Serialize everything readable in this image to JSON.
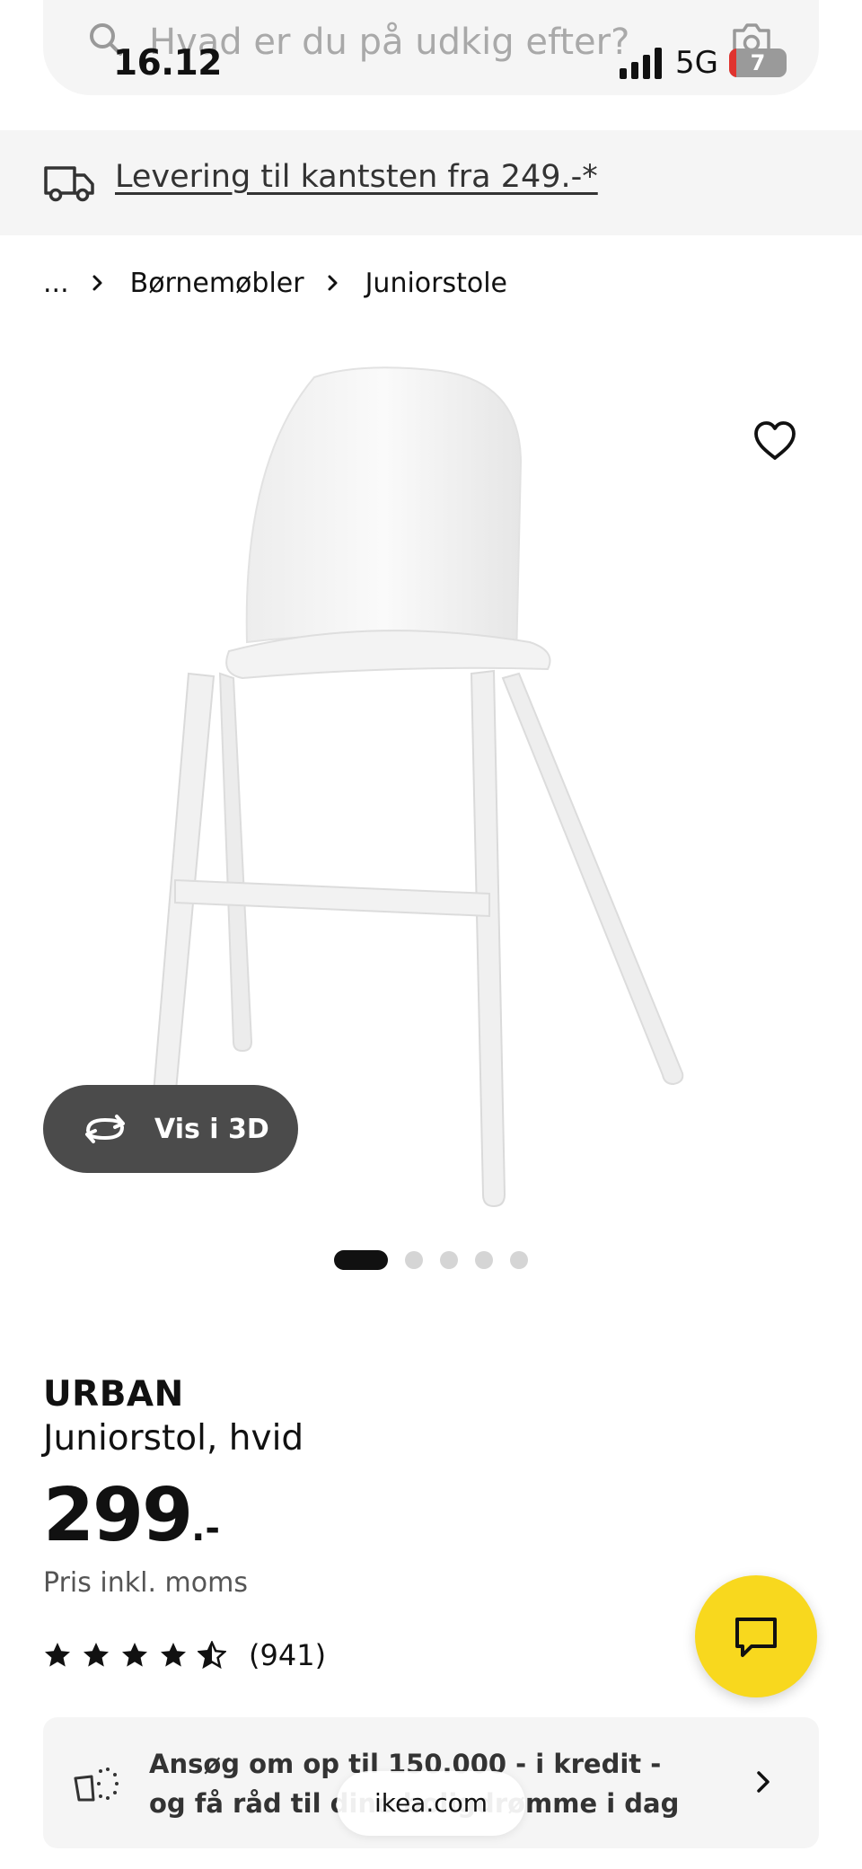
{
  "status_bar": {
    "time": "16.12",
    "network": "5G",
    "battery_level": "7"
  },
  "search": {
    "placeholder": "Hvad er du på udkig efter?"
  },
  "delivery_banner": {
    "text": "Levering til kantsten fra 249.-*"
  },
  "breadcrumb": {
    "ellipsis": "...",
    "items": [
      "Børnemøbler",
      "Juniorstole"
    ]
  },
  "gallery": {
    "view_3d_label": "Vis i 3D",
    "image_count": 5,
    "active_index": 0
  },
  "product": {
    "name": "URBAN",
    "description": "Juniorstol, hvid",
    "price": "299",
    "price_suffix": ".-",
    "price_note": "Pris inkl. moms",
    "rating": 4.5,
    "rating_max": 5,
    "review_count": "(941)"
  },
  "credit_banner": {
    "text": "Ansøg om op til 150.000 - i kredit - og få råd til dine boligdrømme i dag"
  },
  "browser": {
    "url": "ikea.com"
  },
  "colors": {
    "chat_button": "#f8d81e",
    "view_3d_button": "#4b4b4b",
    "banner_bg": "#f5f5f5"
  },
  "icons": [
    "search-icon",
    "camera-icon",
    "truck-icon",
    "chevron-right-icon",
    "heart-icon",
    "rotate-3d-icon",
    "star-icon",
    "chat-icon",
    "sofa-sparkle-icon"
  ]
}
